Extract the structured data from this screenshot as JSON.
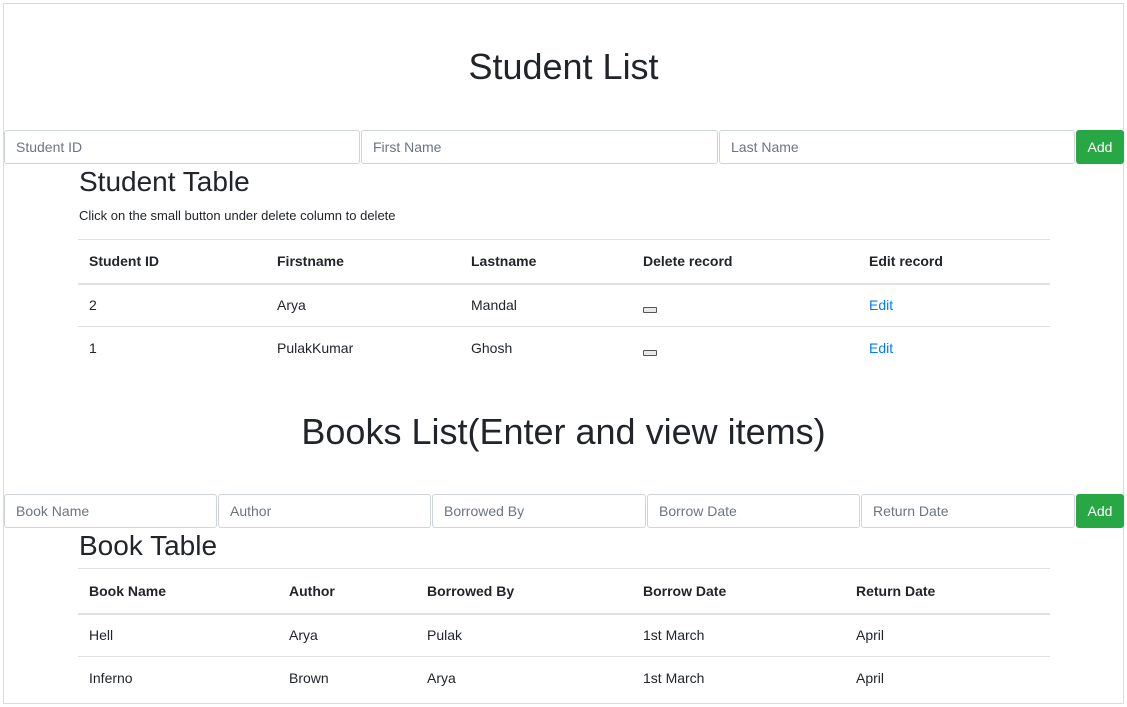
{
  "students": {
    "title": "Student List",
    "inputs": {
      "id_placeholder": "Student ID",
      "first_placeholder": "First Name",
      "last_placeholder": "Last Name"
    },
    "add_label": "Add",
    "table_title": "Student Table",
    "hint": "Click on the small button under delete column to delete",
    "headers": [
      "Student ID",
      "Firstname",
      "Lastname",
      "Delete record",
      "Edit record"
    ],
    "rows": [
      {
        "id": "2",
        "first": "Arya",
        "last": "Mandal",
        "edit": "Edit"
      },
      {
        "id": "1",
        "first": "PulakKumar",
        "last": "Ghosh",
        "edit": "Edit"
      }
    ]
  },
  "books": {
    "title": "Books List(Enter and view items)",
    "inputs": {
      "name_placeholder": "Book Name",
      "author_placeholder": "Author",
      "borrowed_placeholder": "Borrowed By",
      "borrow_date_placeholder": "Borrow Date",
      "return_date_placeholder": "Return Date"
    },
    "add_label": "Add",
    "table_title": "Book Table",
    "headers": [
      "Book Name",
      "Author",
      "Borrowed By",
      "Borrow Date",
      "Return Date"
    ],
    "rows": [
      {
        "name": "Hell",
        "author": "Arya",
        "borrowed_by": "Pulak",
        "borrow_date": "1st March",
        "return_date": "April"
      },
      {
        "name": "Inferno",
        "author": "Brown",
        "borrowed_by": "Arya",
        "borrow_date": "1st March",
        "return_date": "April"
      }
    ]
  },
  "colors": {
    "add_button": "#28a745",
    "link": "#007bff"
  }
}
